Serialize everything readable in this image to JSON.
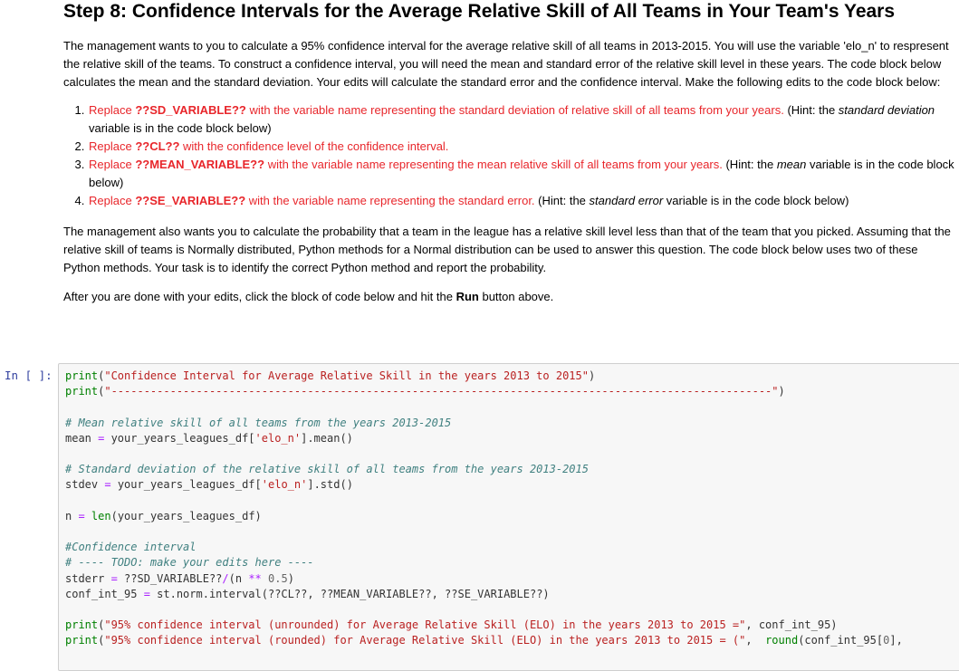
{
  "header": {
    "title": "Step 8: Confidence Intervals for the Average Relative Skill of All Teams in Your Team's Years"
  },
  "intro": "The management wants to you to calculate a 95% confidence interval for the average relative skill of all teams in 2013-2015. You will use the variable 'elo_n' to respresent the relative skill of the teams. To construct a confidence interval, you will need the mean and standard error of the relative skill level in these years. The code block below calculates the mean and the standard deviation. Your edits will calculate the standard error and the confidence interval. Make the following edits to the code block below:",
  "edits": [
    {
      "replace": "Replace ",
      "token": "??SD_VARIABLE??",
      "rest": " with the variable name representing the standard deviation of relative skill of all teams from your years.",
      "hint_pre": " (Hint: the ",
      "hint_em": "standard deviation",
      "hint_post": " variable is in the code block below)"
    },
    {
      "replace": "Replace ",
      "token": "??CL??",
      "rest": " with the confidence level of the confidence interval.",
      "hint_pre": "",
      "hint_em": "",
      "hint_post": ""
    },
    {
      "replace": "Replace ",
      "token": "??MEAN_VARIABLE??",
      "rest": " with the variable name representing the mean relative skill of all teams from your years.",
      "hint_pre": " (Hint: the ",
      "hint_em": "mean",
      "hint_post": " variable is in the code block below)"
    },
    {
      "replace": "Replace ",
      "token": "??SE_VARIABLE??",
      "rest": " with the variable name representing the standard error.",
      "hint_pre": " (Hint: the ",
      "hint_em": "standard error",
      "hint_post": " variable is in the code block below)"
    }
  ],
  "para2": "The management also wants you to calculate the probability that a team in the league has a relative skill level less than that of the team that you picked. Assuming that the relative skill of teams is Normally distributed, Python methods for a Normal distribution can be used to answer this question. The code block below uses two of these Python methods. Your task is to identify the correct Python method and report the probability.",
  "para3": {
    "pre": "After you are done with your edits, click the block of code below and hit the ",
    "bold": "Run",
    "post": " button above."
  },
  "cell": {
    "prompt": "In [ ]:",
    "lines": [
      [
        [
          "kw",
          "print"
        ],
        [
          "",
          "("
        ],
        [
          "st",
          "\"Confidence Interval for Average Relative Skill in the years 2013 to 2015\""
        ],
        [
          "",
          ")"
        ]
      ],
      [
        [
          "kw",
          "print"
        ],
        [
          "",
          "("
        ],
        [
          "st",
          "\"-----------------------------------------------------------------------------------------------------\""
        ],
        [
          "",
          ")"
        ]
      ],
      [],
      [
        [
          "cm",
          "# Mean relative skill of all teams from the years 2013-2015"
        ]
      ],
      [
        [
          "",
          "mean "
        ],
        [
          "op",
          "="
        ],
        [
          "",
          " your_years_leagues_df["
        ],
        [
          "st",
          "'elo_n'"
        ],
        [
          "",
          "].mean()"
        ]
      ],
      [],
      [
        [
          "cm",
          "# Standard deviation of the relative skill of all teams from the years 2013-2015"
        ]
      ],
      [
        [
          "",
          "stdev "
        ],
        [
          "op",
          "="
        ],
        [
          "",
          " your_years_leagues_df["
        ],
        [
          "st",
          "'elo_n'"
        ],
        [
          "",
          "].std()"
        ]
      ],
      [],
      [
        [
          "",
          "n "
        ],
        [
          "op",
          "="
        ],
        [
          "",
          " "
        ],
        [
          "kw",
          "len"
        ],
        [
          "",
          "(your_years_leagues_df)"
        ]
      ],
      [],
      [
        [
          "cm",
          "#Confidence interval"
        ]
      ],
      [
        [
          "cm",
          "# ---- TODO: make your edits here ----"
        ]
      ],
      [
        [
          "",
          "stderr "
        ],
        [
          "op",
          "="
        ],
        [
          "",
          " ??SD_VARIABLE??"
        ],
        [
          "op",
          "/"
        ],
        [
          "",
          "(n "
        ],
        [
          "op",
          "**"
        ],
        [
          "",
          " "
        ],
        [
          "nm",
          "0.5"
        ],
        [
          "",
          ")"
        ]
      ],
      [
        [
          "",
          "conf_int_95 "
        ],
        [
          "op",
          "="
        ],
        [
          "",
          " st.norm.interval(??CL??, ??MEAN_VARIABLE??, ??SE_VARIABLE??)"
        ]
      ],
      [],
      [
        [
          "kw",
          "print"
        ],
        [
          "",
          "("
        ],
        [
          "st",
          "\"95% confidence interval (unrounded) for Average Relative Skill (ELO) in the years 2013 to 2015 =\""
        ],
        [
          "",
          ", conf_int_95)"
        ]
      ],
      [
        [
          "kw",
          "print"
        ],
        [
          "",
          "("
        ],
        [
          "st",
          "\"95% confidence interval (rounded) for Average Relative Skill (ELO) in the years 2013 to 2015 = (\""
        ],
        [
          "",
          ",  "
        ],
        [
          "kw",
          "round"
        ],
        [
          "",
          "(conf_int_95["
        ],
        [
          "nm",
          "0"
        ],
        [
          "",
          "],"
        ]
      ]
    ]
  }
}
